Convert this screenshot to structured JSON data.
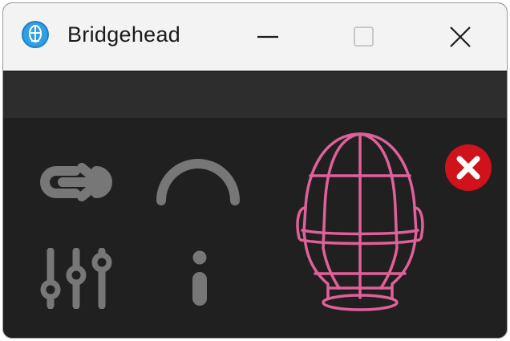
{
  "window": {
    "title": "Bridgehead",
    "icon": "app-globe-icon",
    "controls": [
      "minimize-icon",
      "maximize-icon",
      "close-icon"
    ]
  },
  "tools": [
    {
      "name": "link-icon"
    },
    {
      "name": "arc-gauge-icon"
    },
    {
      "name": "sliders-icon"
    },
    {
      "name": "info-icon"
    }
  ],
  "preview": {
    "icon": "wireframe-head-icon",
    "color": "#e0609a"
  },
  "status": {
    "icon": "error-icon",
    "color": "#d0121c"
  },
  "colors": {
    "titlebar": "#f3f3f3",
    "toolbar": "#2d2d2d",
    "content": "#202020",
    "icon_gray": "#777777",
    "accent_pink": "#e0609a",
    "error_red": "#d0121c"
  }
}
